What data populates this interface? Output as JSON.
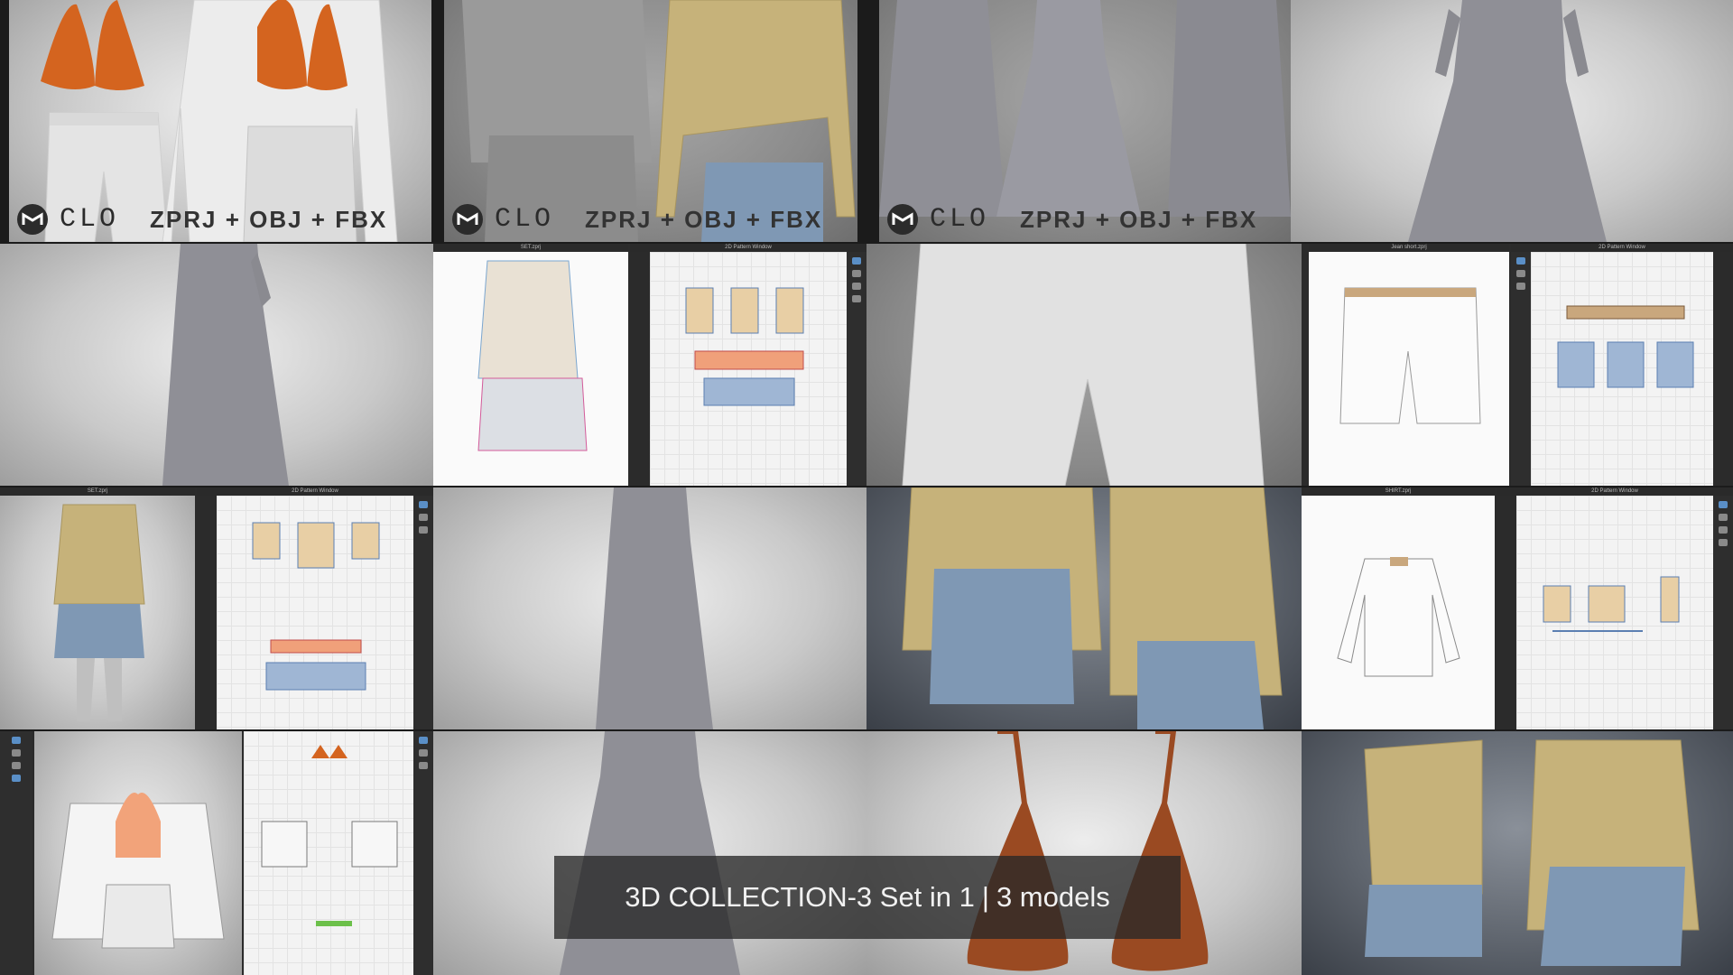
{
  "brand": {
    "name": "CLO",
    "formats": "ZPRJ + OBJ + FBX"
  },
  "caption": {
    "title": "3D COLLECTION-3 Set in 1",
    "separator": "|",
    "models": "3 models"
  },
  "windows": {
    "set_3d": "SET.zprj",
    "pattern_2d": "2D Pattern Window",
    "jean_short": "Jean short.zprj",
    "shirt": "SHIRT.zprj"
  },
  "colors": {
    "bikini": "#d4641f",
    "bikini_brown": "#9a4a22",
    "satin": "#c6b27a",
    "denim": "#7f98b4",
    "dress": "#8f8f96",
    "white_garment": "#eeeeee",
    "caption_bg": "#282828"
  }
}
